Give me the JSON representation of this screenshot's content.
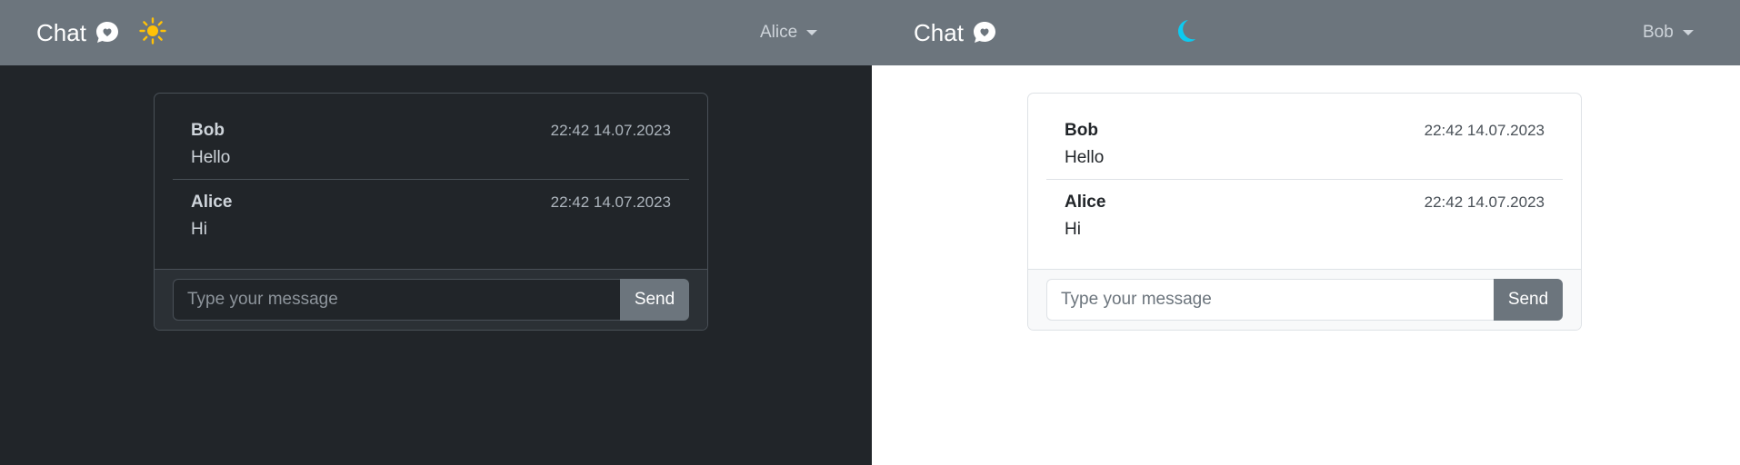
{
  "colors": {
    "navbar": "#6c757d",
    "dark_bg": "#212529",
    "light_bg": "#ffffff",
    "sun": "#ffc107",
    "moon": "#0dcaf0",
    "send_button": "#6c757d"
  },
  "panes": [
    {
      "theme": "dark",
      "brand": "Chat",
      "brand_icon": "chat-heart-icon",
      "theme_icon": "sun-icon",
      "user": "Alice",
      "messages": [
        {
          "author": "Bob",
          "time": "22:42 14.07.2023",
          "text": "Hello"
        },
        {
          "author": "Alice",
          "time": "22:42 14.07.2023",
          "text": "Hi"
        }
      ],
      "input_placeholder": "Type your message",
      "send_label": "Send"
    },
    {
      "theme": "light",
      "brand": "Chat",
      "brand_icon": "chat-heart-icon",
      "theme_icon": "moon-icon",
      "user": "Bob",
      "messages": [
        {
          "author": "Bob",
          "time": "22:42 14.07.2023",
          "text": "Hello"
        },
        {
          "author": "Alice",
          "time": "22:42 14.07.2023",
          "text": "Hi"
        }
      ],
      "input_placeholder": "Type your message",
      "send_label": "Send"
    }
  ]
}
